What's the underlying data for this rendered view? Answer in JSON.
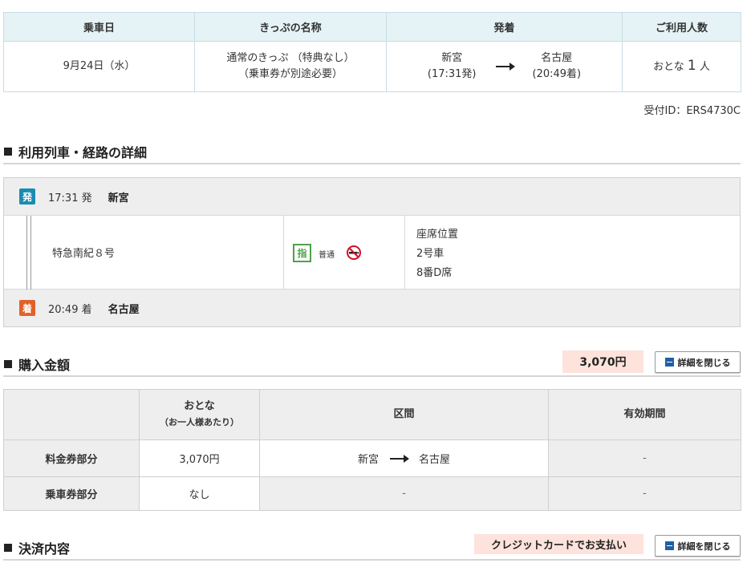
{
  "summary": {
    "headers": {
      "date": "乗車日",
      "ticket_name": "きっぷの名称",
      "route": "発着",
      "passengers": "ご利用人数"
    },
    "date": "9月24日（水）",
    "ticket_name_line1": "通常のきっぷ （特典なし）",
    "ticket_name_line2": "（乗車券が別途必要）",
    "from_station": "新宮",
    "from_time": "(17:31発)",
    "to_station": "名古屋",
    "to_time": "(20:49着)",
    "passenger_label": "おとな",
    "passenger_count": "1",
    "passenger_unit": "人"
  },
  "receipt_id": "受付ID：ERS4730C",
  "route_detail": {
    "title": "利用列車・経路の詳細",
    "departure_badge": "発",
    "departure_time": "17:31 発",
    "departure_station": "新宮",
    "train_name": "特急南紀８号",
    "reserved_mark": "指",
    "car_class": "普通",
    "seat_label": "座席位置",
    "car_number": "2号車",
    "seat_number": "8番D席",
    "arrival_badge": "着",
    "arrival_time": "20:49 着",
    "arrival_station": "名古屋"
  },
  "purchase": {
    "title": "購入金額",
    "total": "3,070円",
    "close_label": "詳細を閉じる",
    "table": {
      "col_adult": "おとな",
      "col_adult_sub": "（お一人様あたり）",
      "col_section": "区間",
      "col_validity": "有効期間",
      "rows": [
        {
          "label": "料金券部分",
          "price": "3,070円",
          "from": "新宮",
          "to": "名古屋",
          "validity": "-"
        },
        {
          "label": "乗車券部分",
          "price": "なし",
          "section": "-",
          "validity": "-"
        }
      ]
    }
  },
  "payment": {
    "title": "決済内容",
    "method": "クレジットカードでお支払い",
    "close_label": "詳細を閉じる"
  },
  "colors": {
    "header_bg": "#e6f3f6",
    "departure_badge": "#1a8cb3",
    "arrival_badge": "#e0622b",
    "reserved_green": "#4ea24a",
    "highlight_pink": "#fde3dc",
    "button_icon_blue": "#1f5fa8"
  }
}
